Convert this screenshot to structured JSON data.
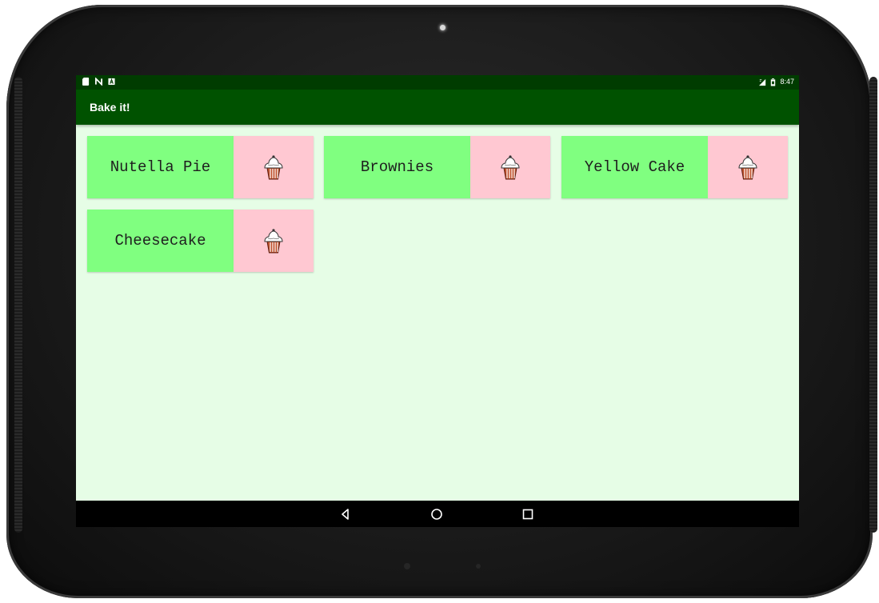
{
  "status_bar": {
    "left_icons": [
      "sd-card-icon",
      "n-icon",
      "a-icon"
    ],
    "right_icons": [
      "signal-icon",
      "battery-icon"
    ],
    "time": "8:47"
  },
  "app_bar": {
    "title": "Bake it!"
  },
  "recipes": [
    {
      "name": "Nutella Pie",
      "icon": "cupcake-icon"
    },
    {
      "name": "Brownies",
      "icon": "cupcake-icon"
    },
    {
      "name": "Yellow Cake",
      "icon": "cupcake-icon"
    },
    {
      "name": "Cheesecake",
      "icon": "cupcake-icon"
    }
  ],
  "nav_bar": {
    "buttons": [
      "back-icon",
      "home-icon",
      "recents-icon"
    ]
  },
  "colors": {
    "status_bar": "#003c00",
    "app_bar": "#005200",
    "background": "#e6fde6",
    "card_label": "#80ff80",
    "card_thumb": "#ffc8d2"
  }
}
